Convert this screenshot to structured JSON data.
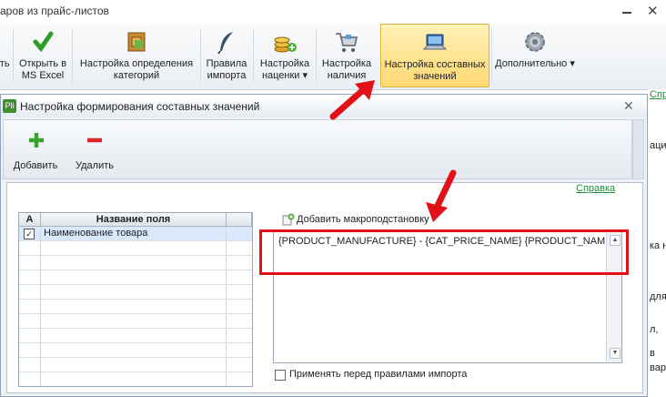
{
  "app": {
    "title": "аров из прайс-листов"
  },
  "ribbon": {
    "items": [
      {
        "label": "ать",
        "icon": "partial-icon"
      },
      {
        "label": "Открыть в MS Excel",
        "icon": "excel-check-icon"
      },
      {
        "label": "Настройка определения категорий",
        "icon": "category-box-icon"
      },
      {
        "label": "Правила импорта",
        "icon": "quill-pen-icon"
      },
      {
        "label": "Настройка наценки ▾",
        "icon": "coins-add-icon"
      },
      {
        "label": "Настройка наличия",
        "icon": "shopping-cart-icon"
      },
      {
        "label": "Настройка составных значений",
        "icon": "laptop-icon"
      },
      {
        "label": "Дополнительно ▾",
        "icon": "gear-icon"
      }
    ]
  },
  "background": {
    "link": "Справ",
    "fragments": [
      "ации",
      "ка н",
      "для",
      "л,",
      "в",
      "вара"
    ]
  },
  "dialog": {
    "title": "Настройка формирования составных значений",
    "toolbar": {
      "add_label": "Добавить",
      "delete_label": "Удалить"
    },
    "help_link": "Справка",
    "table": {
      "columns": [
        "A",
        "Название поля"
      ],
      "rows": [
        {
          "checked": true,
          "name": "Наименование товара"
        }
      ]
    },
    "macro_link": "Добавить макроподстановку",
    "formula": "{PRODUCT_MANUFACTURE} - {CAT_PRICE_NAME} {PRODUCT_NAME}",
    "apply_before_import": {
      "label": "Применять перед правилами импорта",
      "checked": false
    }
  },
  "colors": {
    "accent_selected": "#ffd872",
    "annotation": "#e01218",
    "link": "#1f8b3b"
  }
}
